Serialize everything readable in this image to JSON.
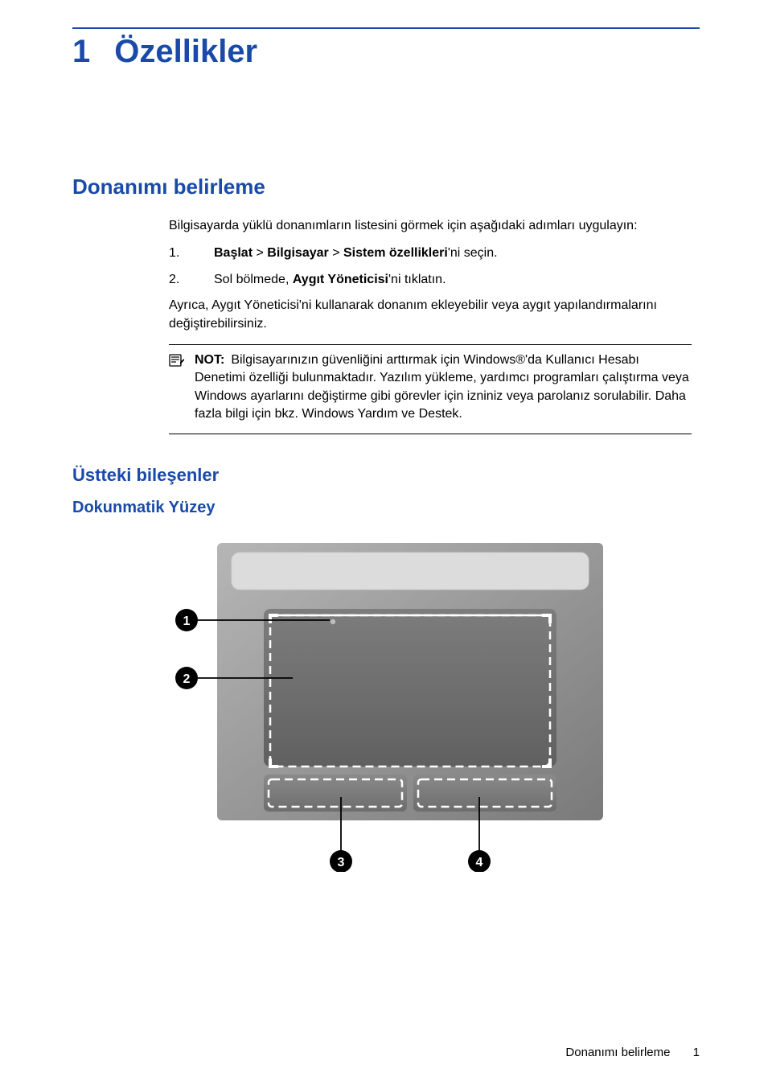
{
  "colors": {
    "accent": "#1a4aa8"
  },
  "chapter": {
    "number": "1",
    "title": "Özellikler"
  },
  "sections": {
    "h2": "Donanımı belirleme",
    "intro": "Bilgisayarda yüklü donanımların listesini görmek için aşağıdaki adımları uygulayın:",
    "step1": {
      "num": "1.",
      "prefix": "Başlat",
      "gt1": " > ",
      "mid": "Bilgisayar",
      "gt2": " > ",
      "suffix": "Sistem özellikleri",
      "tail": "'ni seçin."
    },
    "step2": {
      "num": "2.",
      "prefix": "Sol bölmede, ",
      "bold": "Aygıt Yöneticisi",
      "tail": "'ni tıklatın."
    },
    "para2": "Ayrıca, Aygıt Yöneticisi'ni kullanarak donanım ekleyebilir veya aygıt yapılandırmalarını değiştirebilirsiniz.",
    "note": {
      "label": "NOT:",
      "body": "Bilgisayarınızın güvenliğini arttırmak için Windows®'da Kullanıcı Hesabı Denetimi özelliği bulunmaktadır. Yazılım yükleme, yardımcı programları çalıştırma veya Windows ayarlarını değiştirme gibi görevler için izniniz veya parolanız sorulabilir. Daha fazla bilgi için bkz. Windows Yardım ve Destek."
    },
    "h3": "Üstteki bileşenler",
    "h4": "Dokunmatik Yüzey"
  },
  "callouts": {
    "c1": "1",
    "c2": "2",
    "c3": "3",
    "c4": "4"
  },
  "footer": {
    "section": "Donanımı belirleme",
    "page": "1"
  }
}
